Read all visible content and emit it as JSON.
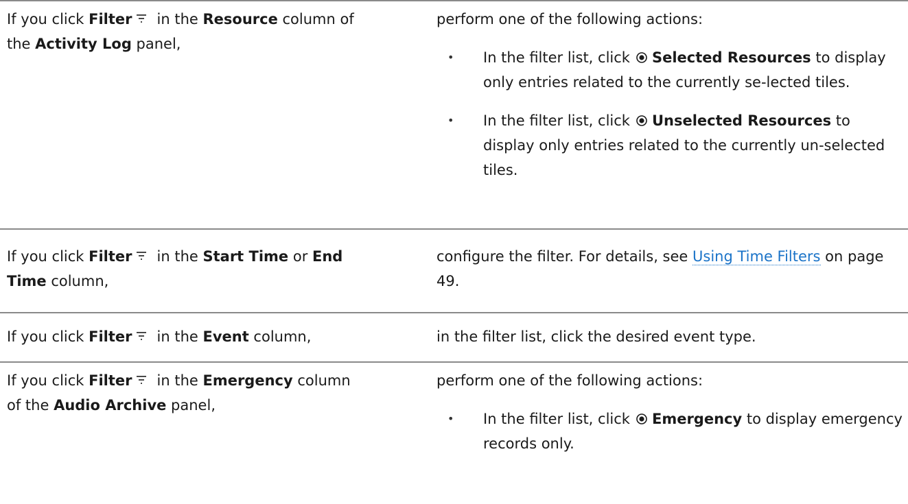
{
  "rows": [
    {
      "left": {
        "prefix": "If you click ",
        "filter": "Filter",
        "mid": "in the ",
        "column": "Resource",
        "column_suffix": " column of",
        "line2_prefix": "the ",
        "panel": "Activity Log",
        "panel_suffix": " panel,"
      },
      "right": {
        "intro": "perform one of the following actions:",
        "items": [
          {
            "a": "In the filter list, click",
            "b": "Selected Resources",
            "c": " to display only entries related to the currently se-lected tiles."
          },
          {
            "a": "In the filter list, click",
            "b": "Unselected Resources",
            "c": " to display only entries related to the currently un-selected tiles."
          }
        ]
      }
    },
    {
      "left": {
        "prefix": "If you click ",
        "filter": "Filter",
        "mid": "in the ",
        "col1": "Start Time",
        "or": " or ",
        "col2a": "End",
        "col2b": "Time",
        "suffix": " column,"
      },
      "right": {
        "a": "configure the filter. For details, see ",
        "link": "Using Time Filters",
        "b": " on page 49."
      }
    },
    {
      "left": {
        "prefix": "If you click ",
        "filter": "Filter",
        "mid": "in the ",
        "column": "Event",
        "suffix": " column,"
      },
      "right": {
        "text": "in the filter list, click the desired event type."
      }
    },
    {
      "left": {
        "prefix": "If you click ",
        "filter": "Filter",
        "mid": "in the ",
        "column": "Emergency",
        "column_suffix": " column",
        "line2_prefix": "of the ",
        "panel": "Audio Archive",
        "panel_suffix": " panel,"
      },
      "right": {
        "intro": "perform one of the following actions:",
        "items": [
          {
            "a": "In the filter list, click",
            "b": "Emergency",
            "c": " to display emergency records only."
          }
        ]
      }
    }
  ],
  "icons": {
    "filter": "filter-icon",
    "radio": "radio-selected-icon"
  },
  "colors": {
    "link": "#1a73c8",
    "rule": "#8a8a8a"
  }
}
